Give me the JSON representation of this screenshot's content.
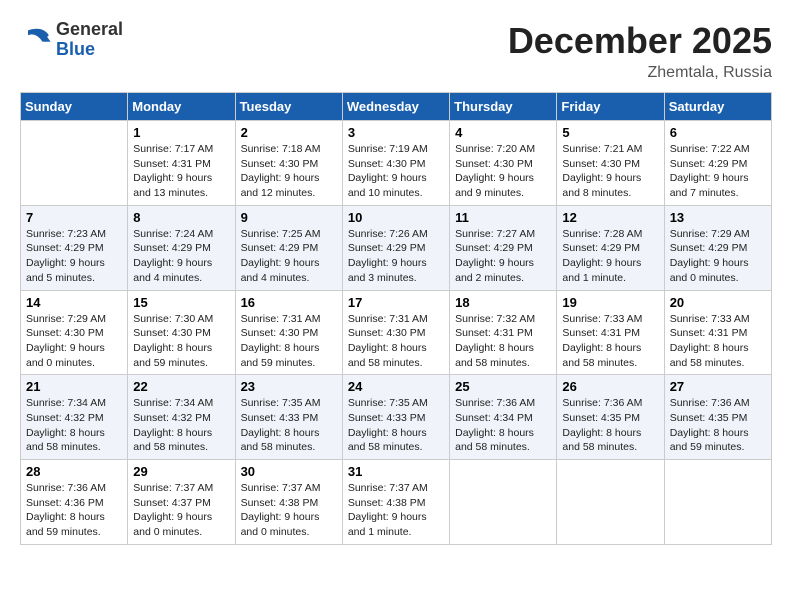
{
  "header": {
    "logo": {
      "general": "General",
      "blue": "Blue"
    },
    "month": "December 2025",
    "location": "Zhemtala, Russia"
  },
  "calendar": {
    "days_of_week": [
      "Sunday",
      "Monday",
      "Tuesday",
      "Wednesday",
      "Thursday",
      "Friday",
      "Saturday"
    ],
    "weeks": [
      [
        {
          "day": "",
          "sunrise": "",
          "sunset": "",
          "daylight": ""
        },
        {
          "day": "1",
          "sunrise": "Sunrise: 7:17 AM",
          "sunset": "Sunset: 4:31 PM",
          "daylight": "Daylight: 9 hours and 13 minutes."
        },
        {
          "day": "2",
          "sunrise": "Sunrise: 7:18 AM",
          "sunset": "Sunset: 4:30 PM",
          "daylight": "Daylight: 9 hours and 12 minutes."
        },
        {
          "day": "3",
          "sunrise": "Sunrise: 7:19 AM",
          "sunset": "Sunset: 4:30 PM",
          "daylight": "Daylight: 9 hours and 10 minutes."
        },
        {
          "day": "4",
          "sunrise": "Sunrise: 7:20 AM",
          "sunset": "Sunset: 4:30 PM",
          "daylight": "Daylight: 9 hours and 9 minutes."
        },
        {
          "day": "5",
          "sunrise": "Sunrise: 7:21 AM",
          "sunset": "Sunset: 4:30 PM",
          "daylight": "Daylight: 9 hours and 8 minutes."
        },
        {
          "day": "6",
          "sunrise": "Sunrise: 7:22 AM",
          "sunset": "Sunset: 4:29 PM",
          "daylight": "Daylight: 9 hours and 7 minutes."
        }
      ],
      [
        {
          "day": "7",
          "sunrise": "Sunrise: 7:23 AM",
          "sunset": "Sunset: 4:29 PM",
          "daylight": "Daylight: 9 hours and 5 minutes."
        },
        {
          "day": "8",
          "sunrise": "Sunrise: 7:24 AM",
          "sunset": "Sunset: 4:29 PM",
          "daylight": "Daylight: 9 hours and 4 minutes."
        },
        {
          "day": "9",
          "sunrise": "Sunrise: 7:25 AM",
          "sunset": "Sunset: 4:29 PM",
          "daylight": "Daylight: 9 hours and 4 minutes."
        },
        {
          "day": "10",
          "sunrise": "Sunrise: 7:26 AM",
          "sunset": "Sunset: 4:29 PM",
          "daylight": "Daylight: 9 hours and 3 minutes."
        },
        {
          "day": "11",
          "sunrise": "Sunrise: 7:27 AM",
          "sunset": "Sunset: 4:29 PM",
          "daylight": "Daylight: 9 hours and 2 minutes."
        },
        {
          "day": "12",
          "sunrise": "Sunrise: 7:28 AM",
          "sunset": "Sunset: 4:29 PM",
          "daylight": "Daylight: 9 hours and 1 minute."
        },
        {
          "day": "13",
          "sunrise": "Sunrise: 7:29 AM",
          "sunset": "Sunset: 4:29 PM",
          "daylight": "Daylight: 9 hours and 0 minutes."
        }
      ],
      [
        {
          "day": "14",
          "sunrise": "Sunrise: 7:29 AM",
          "sunset": "Sunset: 4:30 PM",
          "daylight": "Daylight: 9 hours and 0 minutes."
        },
        {
          "day": "15",
          "sunrise": "Sunrise: 7:30 AM",
          "sunset": "Sunset: 4:30 PM",
          "daylight": "Daylight: 8 hours and 59 minutes."
        },
        {
          "day": "16",
          "sunrise": "Sunrise: 7:31 AM",
          "sunset": "Sunset: 4:30 PM",
          "daylight": "Daylight: 8 hours and 59 minutes."
        },
        {
          "day": "17",
          "sunrise": "Sunrise: 7:31 AM",
          "sunset": "Sunset: 4:30 PM",
          "daylight": "Daylight: 8 hours and 58 minutes."
        },
        {
          "day": "18",
          "sunrise": "Sunrise: 7:32 AM",
          "sunset": "Sunset: 4:31 PM",
          "daylight": "Daylight: 8 hours and 58 minutes."
        },
        {
          "day": "19",
          "sunrise": "Sunrise: 7:33 AM",
          "sunset": "Sunset: 4:31 PM",
          "daylight": "Daylight: 8 hours and 58 minutes."
        },
        {
          "day": "20",
          "sunrise": "Sunrise: 7:33 AM",
          "sunset": "Sunset: 4:31 PM",
          "daylight": "Daylight: 8 hours and 58 minutes."
        }
      ],
      [
        {
          "day": "21",
          "sunrise": "Sunrise: 7:34 AM",
          "sunset": "Sunset: 4:32 PM",
          "daylight": "Daylight: 8 hours and 58 minutes."
        },
        {
          "day": "22",
          "sunrise": "Sunrise: 7:34 AM",
          "sunset": "Sunset: 4:32 PM",
          "daylight": "Daylight: 8 hours and 58 minutes."
        },
        {
          "day": "23",
          "sunrise": "Sunrise: 7:35 AM",
          "sunset": "Sunset: 4:33 PM",
          "daylight": "Daylight: 8 hours and 58 minutes."
        },
        {
          "day": "24",
          "sunrise": "Sunrise: 7:35 AM",
          "sunset": "Sunset: 4:33 PM",
          "daylight": "Daylight: 8 hours and 58 minutes."
        },
        {
          "day": "25",
          "sunrise": "Sunrise: 7:36 AM",
          "sunset": "Sunset: 4:34 PM",
          "daylight": "Daylight: 8 hours and 58 minutes."
        },
        {
          "day": "26",
          "sunrise": "Sunrise: 7:36 AM",
          "sunset": "Sunset: 4:35 PM",
          "daylight": "Daylight: 8 hours and 58 minutes."
        },
        {
          "day": "27",
          "sunrise": "Sunrise: 7:36 AM",
          "sunset": "Sunset: 4:35 PM",
          "daylight": "Daylight: 8 hours and 59 minutes."
        }
      ],
      [
        {
          "day": "28",
          "sunrise": "Sunrise: 7:36 AM",
          "sunset": "Sunset: 4:36 PM",
          "daylight": "Daylight: 8 hours and 59 minutes."
        },
        {
          "day": "29",
          "sunrise": "Sunrise: 7:37 AM",
          "sunset": "Sunset: 4:37 PM",
          "daylight": "Daylight: 9 hours and 0 minutes."
        },
        {
          "day": "30",
          "sunrise": "Sunrise: 7:37 AM",
          "sunset": "Sunset: 4:38 PM",
          "daylight": "Daylight: 9 hours and 0 minutes."
        },
        {
          "day": "31",
          "sunrise": "Sunrise: 7:37 AM",
          "sunset": "Sunset: 4:38 PM",
          "daylight": "Daylight: 9 hours and 1 minute."
        },
        {
          "day": "",
          "sunrise": "",
          "sunset": "",
          "daylight": ""
        },
        {
          "day": "",
          "sunrise": "",
          "sunset": "",
          "daylight": ""
        },
        {
          "day": "",
          "sunrise": "",
          "sunset": "",
          "daylight": ""
        }
      ]
    ]
  }
}
